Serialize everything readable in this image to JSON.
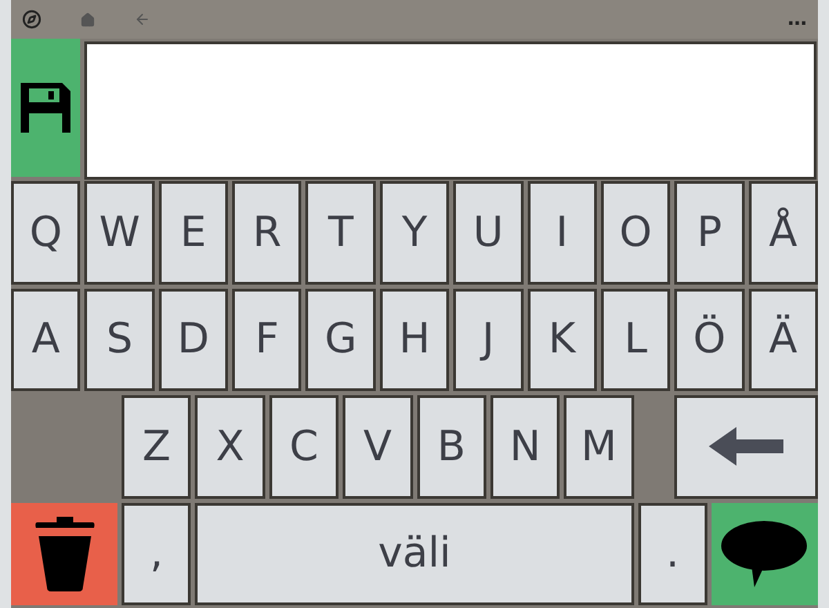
{
  "toolbar": {
    "more": "…"
  },
  "rows": [
    [
      {
        "kind": "letter",
        "label": "Q"
      },
      {
        "kind": "letter",
        "label": "W"
      },
      {
        "kind": "letter",
        "label": "E"
      },
      {
        "kind": "letter",
        "label": "R"
      },
      {
        "kind": "letter",
        "label": "T"
      },
      {
        "kind": "letter",
        "label": "Y"
      },
      {
        "kind": "letter",
        "label": "U"
      },
      {
        "kind": "letter",
        "label": "I"
      },
      {
        "kind": "letter",
        "label": "O"
      },
      {
        "kind": "letter",
        "label": "P"
      },
      {
        "kind": "letter",
        "label": "Å"
      }
    ],
    [
      {
        "kind": "letter",
        "label": "A"
      },
      {
        "kind": "letter",
        "label": "S"
      },
      {
        "kind": "letter",
        "label": "D"
      },
      {
        "kind": "letter",
        "label": "F"
      },
      {
        "kind": "letter",
        "label": "G"
      },
      {
        "kind": "letter",
        "label": "H"
      },
      {
        "kind": "letter",
        "label": "J"
      },
      {
        "kind": "letter",
        "label": "K"
      },
      {
        "kind": "letter",
        "label": "L"
      },
      {
        "kind": "letter",
        "label": "Ö"
      },
      {
        "kind": "letter",
        "label": "Ä"
      }
    ],
    [
      {
        "kind": "letter",
        "label": "Z"
      },
      {
        "kind": "letter",
        "label": "X"
      },
      {
        "kind": "letter",
        "label": "C"
      },
      {
        "kind": "letter",
        "label": "V"
      },
      {
        "kind": "letter",
        "label": "B"
      },
      {
        "kind": "letter",
        "label": "N"
      },
      {
        "kind": "letter",
        "label": "M"
      },
      {
        "kind": "backspace"
      }
    ],
    [
      {
        "kind": "clear"
      },
      {
        "kind": "letter",
        "label": ","
      },
      {
        "kind": "space",
        "label": "väli"
      },
      {
        "kind": "letter",
        "label": "."
      },
      {
        "kind": "speak"
      }
    ]
  ]
}
